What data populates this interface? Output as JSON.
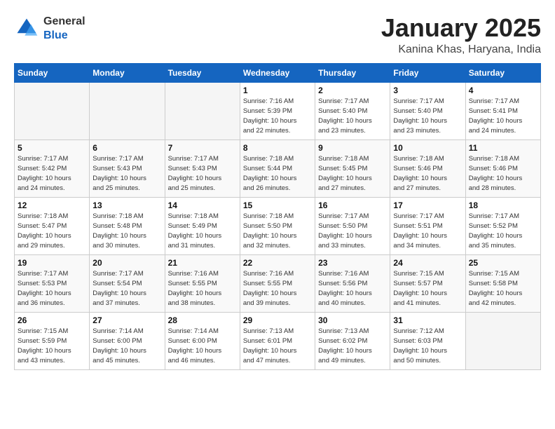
{
  "header": {
    "logo_general": "General",
    "logo_blue": "Blue",
    "title": "January 2025",
    "subtitle": "Kanina Khas, Haryana, India"
  },
  "days_of_week": [
    "Sunday",
    "Monday",
    "Tuesday",
    "Wednesday",
    "Thursday",
    "Friday",
    "Saturday"
  ],
  "weeks": [
    [
      {
        "day": "",
        "info": ""
      },
      {
        "day": "",
        "info": ""
      },
      {
        "day": "",
        "info": ""
      },
      {
        "day": "1",
        "info": "Sunrise: 7:16 AM\nSunset: 5:39 PM\nDaylight: 10 hours\nand 22 minutes."
      },
      {
        "day": "2",
        "info": "Sunrise: 7:17 AM\nSunset: 5:40 PM\nDaylight: 10 hours\nand 23 minutes."
      },
      {
        "day": "3",
        "info": "Sunrise: 7:17 AM\nSunset: 5:40 PM\nDaylight: 10 hours\nand 23 minutes."
      },
      {
        "day": "4",
        "info": "Sunrise: 7:17 AM\nSunset: 5:41 PM\nDaylight: 10 hours\nand 24 minutes."
      }
    ],
    [
      {
        "day": "5",
        "info": "Sunrise: 7:17 AM\nSunset: 5:42 PM\nDaylight: 10 hours\nand 24 minutes."
      },
      {
        "day": "6",
        "info": "Sunrise: 7:17 AM\nSunset: 5:43 PM\nDaylight: 10 hours\nand 25 minutes."
      },
      {
        "day": "7",
        "info": "Sunrise: 7:17 AM\nSunset: 5:43 PM\nDaylight: 10 hours\nand 25 minutes."
      },
      {
        "day": "8",
        "info": "Sunrise: 7:18 AM\nSunset: 5:44 PM\nDaylight: 10 hours\nand 26 minutes."
      },
      {
        "day": "9",
        "info": "Sunrise: 7:18 AM\nSunset: 5:45 PM\nDaylight: 10 hours\nand 27 minutes."
      },
      {
        "day": "10",
        "info": "Sunrise: 7:18 AM\nSunset: 5:46 PM\nDaylight: 10 hours\nand 27 minutes."
      },
      {
        "day": "11",
        "info": "Sunrise: 7:18 AM\nSunset: 5:46 PM\nDaylight: 10 hours\nand 28 minutes."
      }
    ],
    [
      {
        "day": "12",
        "info": "Sunrise: 7:18 AM\nSunset: 5:47 PM\nDaylight: 10 hours\nand 29 minutes."
      },
      {
        "day": "13",
        "info": "Sunrise: 7:18 AM\nSunset: 5:48 PM\nDaylight: 10 hours\nand 30 minutes."
      },
      {
        "day": "14",
        "info": "Sunrise: 7:18 AM\nSunset: 5:49 PM\nDaylight: 10 hours\nand 31 minutes."
      },
      {
        "day": "15",
        "info": "Sunrise: 7:18 AM\nSunset: 5:50 PM\nDaylight: 10 hours\nand 32 minutes."
      },
      {
        "day": "16",
        "info": "Sunrise: 7:17 AM\nSunset: 5:50 PM\nDaylight: 10 hours\nand 33 minutes."
      },
      {
        "day": "17",
        "info": "Sunrise: 7:17 AM\nSunset: 5:51 PM\nDaylight: 10 hours\nand 34 minutes."
      },
      {
        "day": "18",
        "info": "Sunrise: 7:17 AM\nSunset: 5:52 PM\nDaylight: 10 hours\nand 35 minutes."
      }
    ],
    [
      {
        "day": "19",
        "info": "Sunrise: 7:17 AM\nSunset: 5:53 PM\nDaylight: 10 hours\nand 36 minutes."
      },
      {
        "day": "20",
        "info": "Sunrise: 7:17 AM\nSunset: 5:54 PM\nDaylight: 10 hours\nand 37 minutes."
      },
      {
        "day": "21",
        "info": "Sunrise: 7:16 AM\nSunset: 5:55 PM\nDaylight: 10 hours\nand 38 minutes."
      },
      {
        "day": "22",
        "info": "Sunrise: 7:16 AM\nSunset: 5:55 PM\nDaylight: 10 hours\nand 39 minutes."
      },
      {
        "day": "23",
        "info": "Sunrise: 7:16 AM\nSunset: 5:56 PM\nDaylight: 10 hours\nand 40 minutes."
      },
      {
        "day": "24",
        "info": "Sunrise: 7:15 AM\nSunset: 5:57 PM\nDaylight: 10 hours\nand 41 minutes."
      },
      {
        "day": "25",
        "info": "Sunrise: 7:15 AM\nSunset: 5:58 PM\nDaylight: 10 hours\nand 42 minutes."
      }
    ],
    [
      {
        "day": "26",
        "info": "Sunrise: 7:15 AM\nSunset: 5:59 PM\nDaylight: 10 hours\nand 43 minutes."
      },
      {
        "day": "27",
        "info": "Sunrise: 7:14 AM\nSunset: 6:00 PM\nDaylight: 10 hours\nand 45 minutes."
      },
      {
        "day": "28",
        "info": "Sunrise: 7:14 AM\nSunset: 6:00 PM\nDaylight: 10 hours\nand 46 minutes."
      },
      {
        "day": "29",
        "info": "Sunrise: 7:13 AM\nSunset: 6:01 PM\nDaylight: 10 hours\nand 47 minutes."
      },
      {
        "day": "30",
        "info": "Sunrise: 7:13 AM\nSunset: 6:02 PM\nDaylight: 10 hours\nand 49 minutes."
      },
      {
        "day": "31",
        "info": "Sunrise: 7:12 AM\nSunset: 6:03 PM\nDaylight: 10 hours\nand 50 minutes."
      },
      {
        "day": "",
        "info": ""
      }
    ]
  ]
}
